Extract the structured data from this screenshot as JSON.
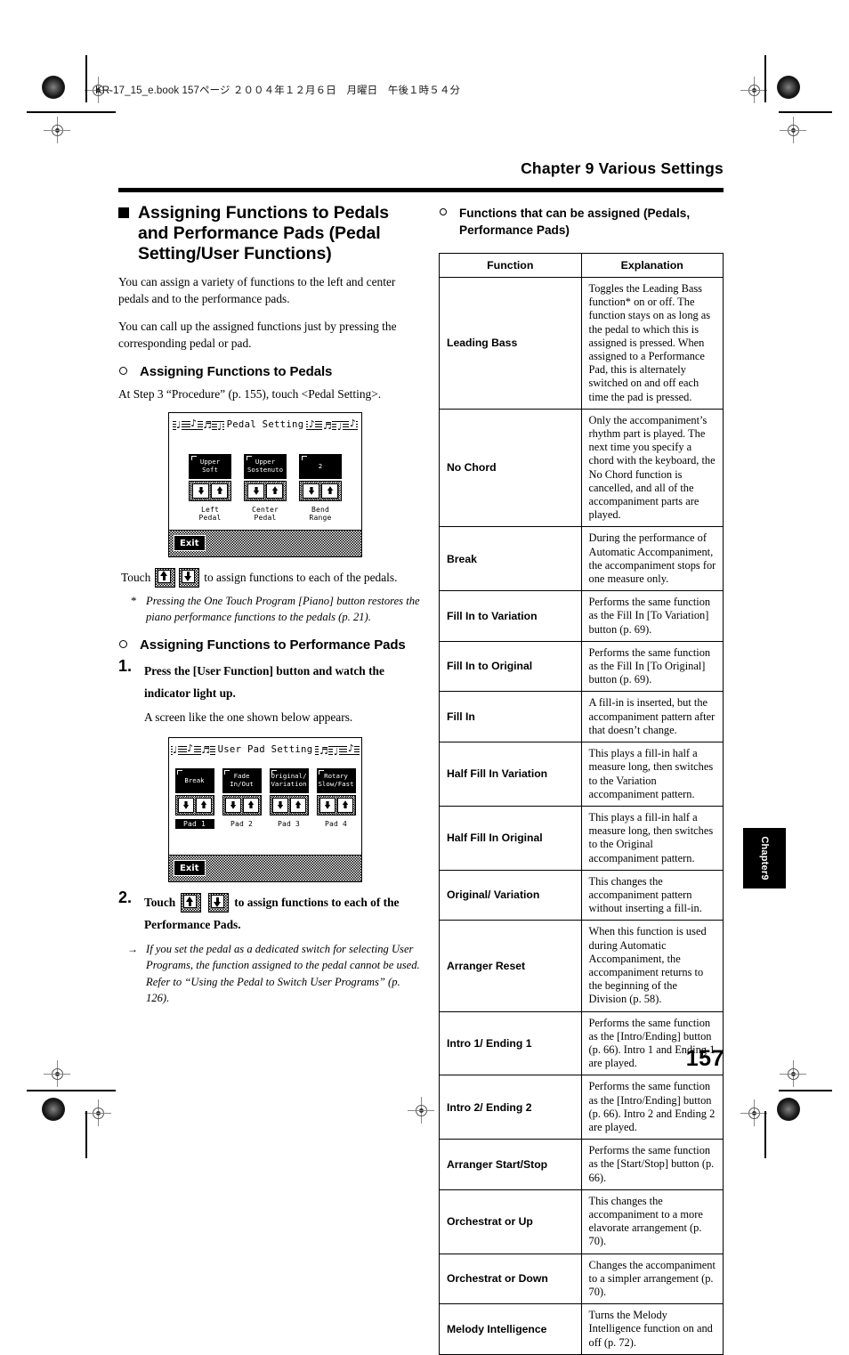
{
  "print_marks": {
    "file_stamp": "KR-17_15_e.book  157ページ  ２００４年１２月６日　月曜日　午後１時５４分"
  },
  "header": {
    "chapter_title": "Chapter 9 Various Settings"
  },
  "left_column": {
    "section_heading": "Assigning Functions to Pedals and Performance Pads (Pedal Setting/User Functions)",
    "intro_paragraph_1": "You can assign a variety of functions to the left and center pedals and to the performance pads.",
    "intro_paragraph_2": "You can call up the assigned functions just by pressing the corresponding pedal or pad.",
    "sub_heading_pedals": "Assigning Functions to Pedals",
    "pedals_instruction": "At Step 3 “Procedure” (p. 155), touch <Pedal Setting>.",
    "pedal_screen": {
      "title": "Pedal Setting",
      "pads": [
        {
          "display": "Upper Soft",
          "caption": "Left Pedal",
          "highlight": false
        },
        {
          "display": "Upper Sostenuto",
          "caption": "Center Pedal",
          "highlight": false
        },
        {
          "display": "2",
          "caption": "Bend Range",
          "highlight": false
        }
      ],
      "exit_label": "Exit"
    },
    "touch_line_1_prefix": "Touch",
    "touch_line_1_suffix": "to assign functions to each of the pedals.",
    "footnote_asterisk": "*",
    "footnote_text": "Pressing the One Touch Program [Piano] button restores the piano performance functions to the pedals (p. 21).",
    "sub_heading_pads": "Assigning Functions to Performance Pads",
    "step1_number": "1.",
    "step1_bold": "Press the [User Function] button and watch the indicator light up.",
    "step1_plain": "A screen like the one shown below appears.",
    "pad_screen": {
      "title": "User Pad Setting",
      "pads": [
        {
          "display": "Break",
          "caption": "Pad 1",
          "highlight": true
        },
        {
          "display": "Fade In/Out",
          "caption": "Pad 2",
          "highlight": false
        },
        {
          "display": "Original/ Variation",
          "caption": "Pad 3",
          "highlight": false
        },
        {
          "display": "Rotary Slow/Fast",
          "caption": "Pad 4",
          "highlight": false
        }
      ],
      "exit_label": "Exit"
    },
    "step2_number": "2.",
    "step2_prefix": "Touch",
    "step2_suffix": "to assign functions to each of the Performance Pads.",
    "note_arrow_marker": "→",
    "note_arrow_text": "If you set the pedal as a dedicated switch for selecting User Programs, the function assigned to the pedal cannot be used. Refer to “Using the Pedal to Switch User Programs” (p. 126)."
  },
  "right_column": {
    "sub_heading": "Functions that can be assigned (Pedals, Performance Pads)",
    "table": {
      "columns": [
        "Function",
        "Explanation"
      ],
      "rows": [
        {
          "function": "Leading Bass",
          "explanation": "Toggles the Leading Bass function* on or off. The function stays on as long as the pedal to which this is assigned is pressed. When assigned to a Performance Pad, this is alternately switched on and off each time the pad is pressed."
        },
        {
          "function": "No Chord",
          "explanation": "Only the accompaniment’s rhythm part is played. The next time you specify a chord with the keyboard, the No Chord function is cancelled, and all of the accompaniment parts are played."
        },
        {
          "function": "Break",
          "explanation": "During the performance of Automatic Accompaniment, the accompaniment stops for one measure only."
        },
        {
          "function": "Fill In to Variation",
          "explanation": "Performs the same function as the Fill In [To Variation] button (p. 69)."
        },
        {
          "function": "Fill In to Original",
          "explanation": "Performs the same function as the Fill In [To Original] button (p. 69)."
        },
        {
          "function": "Fill In",
          "explanation": "A fill-in is inserted, but the accompaniment pattern after that doesn’t change."
        },
        {
          "function": "Half Fill In Variation",
          "explanation": "This plays a fill-in half a measure long, then switches to the Variation accompaniment pattern."
        },
        {
          "function": "Half Fill In Original",
          "explanation": "This plays a fill-in half a measure long, then switches to the Original accompaniment pattern."
        },
        {
          "function": "Original/ Variation",
          "explanation": "This changes the accompaniment pattern without inserting a fill-in."
        },
        {
          "function": "Arranger Reset",
          "explanation": "When this function is used during Automatic Accompaniment, the accompaniment returns to the beginning of the Division (p. 58)."
        },
        {
          "function": "Intro 1/ Ending 1",
          "explanation": "Performs the same function as the [Intro/Ending] button (p. 66). Intro 1 and Ending 1 are played."
        },
        {
          "function": "Intro 2/ Ending 2",
          "explanation": "Performs the same function as the [Intro/Ending] button (p. 66). Intro 2 and Ending 2 are played."
        },
        {
          "function": "Arranger Start/Stop",
          "explanation": "Performs the same function as the [Start/Stop] button (p. 66)."
        },
        {
          "function": "Orchestrat or Up",
          "explanation": "This changes the accompaniment to a more elavorate arrangement (p. 70)."
        },
        {
          "function": "Orchestrat or Down",
          "explanation": "Changes the accompaniment to a simpler arrangement (p. 70)."
        },
        {
          "function": "Melody Intelligence",
          "explanation": "Turns the Melody Intelligence function on and off (p. 72)."
        }
      ]
    }
  },
  "footer": {
    "chapter_tab": "Chapter9",
    "page_number": "157"
  }
}
